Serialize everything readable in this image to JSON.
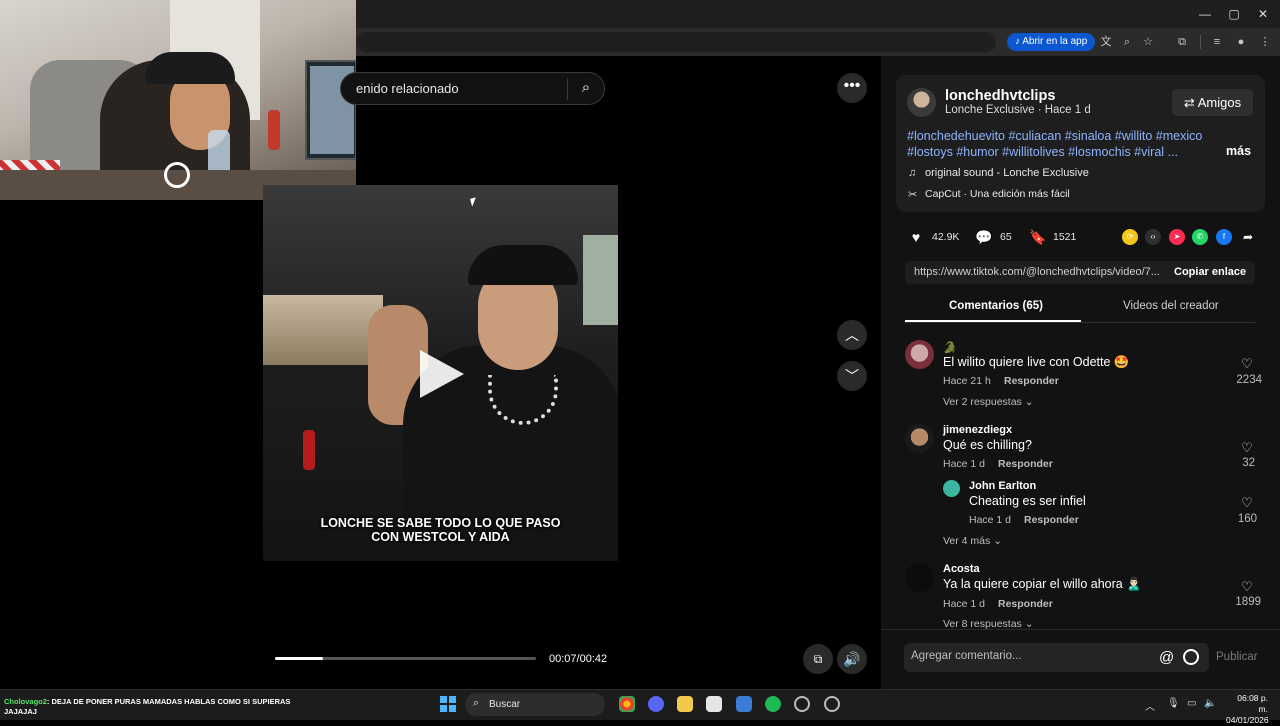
{
  "browser": {
    "window_controls": [
      "—",
      "▢",
      "✕"
    ],
    "open_in_app_label": "Abrir en la app",
    "toolbar_icons": [
      "translate-icon",
      "zoom-icon",
      "star-icon",
      "extensions-icon",
      "media-icon",
      "profile-icon",
      "menu-icon"
    ]
  },
  "video": {
    "search_text": "enido relacionado",
    "caption_line1": "LONCHE SE SABE TODO LO QUE PASO",
    "caption_line2": "CON WESTCOL Y AIDA",
    "timecode": "00:07/00:42",
    "progress_fraction": 0.183
  },
  "post": {
    "username": "lonchedhvtclips",
    "subline": "Lonche Exclusive · Hace 1 d",
    "friends_button": "Amigos",
    "hashtags": "#lonchedehuevito #culiacan #sinaloa #willito #mexico #lostoys #humor #willitolives #losmochis #viral ...",
    "more_label": "más",
    "sound": "original sound - Lonche Exclusive",
    "capcut": "CapCut · Una edición más fácil",
    "likes": "42.9K",
    "comments_count": "65",
    "saves": "1521",
    "url": "https://www.tiktok.com/@lonchedhvtclips/video/7...",
    "copy_link": "Copiar enlace",
    "tab_comments": "Comentarios (65)",
    "tab_creator": "Videos del creador"
  },
  "comments": [
    {
      "user": "🐊",
      "text": "El wilito quiere live con Odette 🤩",
      "time": "Hace 21 h",
      "reply": "Responder",
      "likes": "2234",
      "more": "Ver 2 respuestas"
    },
    {
      "user": "jimenezdiegx",
      "text": "Qué es chilling?",
      "time": "Hace 1 d",
      "reply": "Responder",
      "likes": "32",
      "more": ""
    },
    {
      "user": "John Earlton",
      "text": "Cheating es ser infiel",
      "time": "Hace 1 d",
      "reply": "Responder",
      "likes": "160",
      "more": "Ver 4 más"
    },
    {
      "user": "Acosta",
      "text": "Ya la quiere copiar el willo ahora 🙎🏻‍♂️",
      "time": "Hace 1 d",
      "reply": "Responder",
      "likes": "1899",
      "more": "Ver 8 respuestas"
    }
  ],
  "comment_input": {
    "placeholder": "Agregar comentario...",
    "at": "@",
    "publish": "Publicar"
  },
  "taskbar": {
    "chat_nick": "Cholovago2",
    "chat_text": ": DEJA DE PONER PURAS MAMADAS HABLAS COMO SI SUPIERAS JAJAJAJ",
    "search_label": "Buscar",
    "time": "06:08 p. m.",
    "date": "04/01/2026"
  },
  "colors": {
    "accent_blue": "#0b57d0",
    "hashtag": "#8fb3ff",
    "panel_bg": "#121212"
  }
}
